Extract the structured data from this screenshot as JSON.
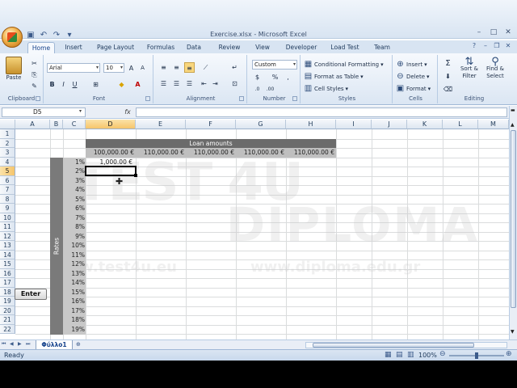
{
  "window": {
    "title": "Exercise.xlsx - Microsoft Excel"
  },
  "qat": [
    "save-icon",
    "undo-icon",
    "redo-icon",
    "customize-icon"
  ],
  "tabs": [
    "Home",
    "Insert",
    "Page Layout",
    "Formulas",
    "Data",
    "Review",
    "View",
    "Developer",
    "Load Test",
    "Team"
  ],
  "ribbon": {
    "clipboard": {
      "label": "Clipboard",
      "paste": "Paste"
    },
    "font": {
      "label": "Font",
      "font_name": "Arial",
      "font_size": "10",
      "bold": "B",
      "italic": "I",
      "underline": "U"
    },
    "alignment": {
      "label": "Alignment"
    },
    "number": {
      "label": "Number",
      "format": "Custom",
      "currency": "$",
      "percent": "%",
      "comma": ","
    },
    "styles": {
      "label": "Styles",
      "conditional": "Conditional Formatting",
      "format_table": "Format as Table",
      "cell_styles": "Cell Styles"
    },
    "cells": {
      "label": "Cells",
      "insert": "Insert",
      "delete": "Delete",
      "format": "Format"
    },
    "editing": {
      "label": "Editing",
      "sum": "Σ",
      "sort": "Sort & Filter",
      "find": "Find & Select"
    }
  },
  "formula_bar": {
    "name_box": "D5",
    "fx": "fx",
    "formula": ""
  },
  "columns": [
    "A",
    "B",
    "C",
    "D",
    "E",
    "F",
    "G",
    "H",
    "I",
    "J",
    "K",
    "L",
    "M"
  ],
  "rows": [
    "1",
    "2",
    "3",
    "4",
    "5",
    "6",
    "7",
    "8",
    "9",
    "10",
    "11",
    "12",
    "13",
    "14",
    "15",
    "16",
    "17",
    "18",
    "19",
    "20",
    "21",
    "22"
  ],
  "sheet": {
    "loan_header": "Loan amounts",
    "loan_amounts": [
      "100,000.00 €",
      "110,000.00 €",
      "110,000.00 €",
      "110,000.00 €",
      "110,000.00 €"
    ],
    "rates_label": "Rates",
    "rates": [
      "1%",
      "2%",
      "3%",
      "4%",
      "5%",
      "6%",
      "7%",
      "8%",
      "9%",
      "10%",
      "11%",
      "12%",
      "13%",
      "14%",
      "15%",
      "16%",
      "17%",
      "18%",
      "19%"
    ],
    "d4_value": "1,000.00 €"
  },
  "sheet_tab": "Φύλλο1",
  "status": {
    "text": "Ready",
    "zoom": "100%"
  },
  "enter_button": "Enter",
  "watermark": {
    "left": "TEST 4U",
    "right": "DIPLOMA",
    "url1": "www.test4u.eu",
    "url2": "www.diploma.edu.gr"
  },
  "colors": {
    "header_band": "#6b6b6b",
    "amount_band": "#bfbfbf",
    "rates_band": "#7a7a7a",
    "ribbon": "#dbe6f3"
  }
}
